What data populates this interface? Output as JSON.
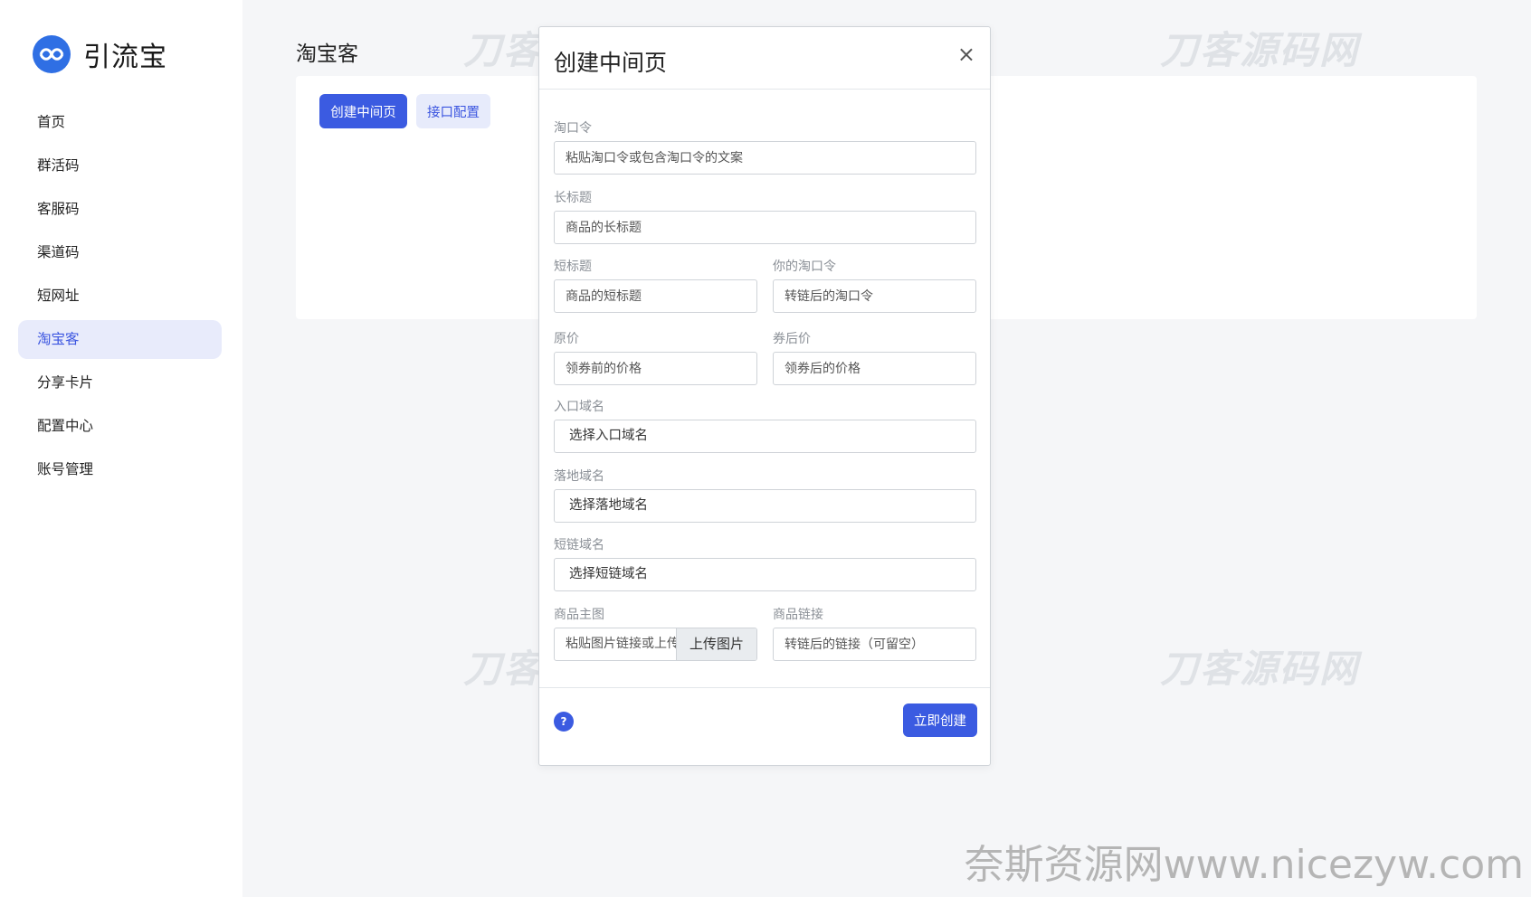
{
  "brand": {
    "name": "引流宝",
    "logo_icon": "chat-bubbles-logo-icon",
    "logo_color": "#2f6fe4"
  },
  "sidebar": {
    "items": [
      {
        "label": "首页"
      },
      {
        "label": "群活码"
      },
      {
        "label": "客服码"
      },
      {
        "label": "渠道码"
      },
      {
        "label": "短网址"
      },
      {
        "label": "淘宝客",
        "active": true
      },
      {
        "label": "分享卡片"
      },
      {
        "label": "配置中心"
      },
      {
        "label": "账号管理"
      }
    ]
  },
  "page": {
    "title": "淘宝客",
    "create_button": "创建中间页",
    "api_config_button": "接口配置"
  },
  "modal": {
    "title": "创建中间页",
    "close_icon": "×",
    "fields": {
      "tkl": {
        "label": "淘口令",
        "placeholder": "粘贴淘口令或包含淘口令的文案"
      },
      "long_title": {
        "label": "长标题",
        "placeholder": "商品的长标题"
      },
      "short_title": {
        "label": "短标题",
        "placeholder": "商品的短标题"
      },
      "your_tkl": {
        "label": "你的淘口令",
        "placeholder": "转链后的淘口令"
      },
      "original_price": {
        "label": "原价",
        "placeholder": "领券前的价格"
      },
      "coupon_price": {
        "label": "券后价",
        "placeholder": "领券后的价格"
      },
      "entry_domain": {
        "label": "入口域名",
        "value": "选择入口域名"
      },
      "landing_domain": {
        "label": "落地域名",
        "value": "选择落地域名"
      },
      "short_domain": {
        "label": "短链域名",
        "value": "选择短链域名"
      },
      "main_image": {
        "label": "商品主图",
        "placeholder": "粘贴图片链接或上传",
        "upload_button": "上传图片"
      },
      "product_link": {
        "label": "商品链接",
        "placeholder": "转链后的链接（可留空）"
      }
    },
    "help_icon": "?",
    "submit_button": "立即创建"
  },
  "watermarks": {
    "text": "刀客源码网",
    "footer": "奈斯资源网www.nicezyw.com"
  },
  "colors": {
    "primary": "#3b5be1",
    "active_bg": "#e8ebfb",
    "page_bg": "#f5f6f8"
  }
}
